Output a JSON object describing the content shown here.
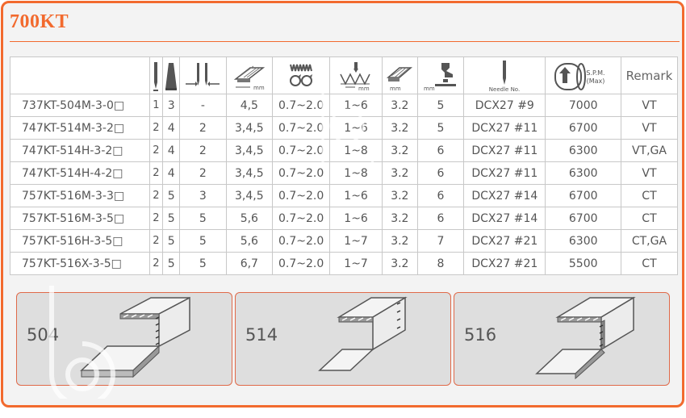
{
  "title": "700KT",
  "header": {
    "header_texts": {
      "mm": "mm",
      "needle_no": "Needle No.",
      "spm": "S.P.M.",
      "max": "(Max)",
      "remark": "Remark"
    },
    "icons": [
      "needle-count-icon",
      "thread-count-icon",
      "needle-gauge-icon",
      "overedge-width-icon",
      "differential-feed-icon",
      "stitch-length-icon",
      "stitch-width-icon",
      "presser-lift-icon",
      "needle-icon",
      "spm-motor-icon"
    ]
  },
  "rows": [
    {
      "model": "737KT-504M-3-0□",
      "needles": "1",
      "threads": "3",
      "gauge": "-",
      "width": "4,5",
      "diff": "0.7~2.0",
      "stitch": "1~6",
      "c8": "3.2",
      "lift": "5",
      "needle": "DCX27 #9",
      "spm": "7000",
      "remark": "VT"
    },
    {
      "model": "747KT-514M-3-2□",
      "needles": "2",
      "threads": "4",
      "gauge": "2",
      "width": "3,4,5",
      "diff": "0.7~2.0",
      "stitch": "1~6",
      "c8": "3.2",
      "lift": "5",
      "needle": "DCX27 #11",
      "spm": "6700",
      "remark": "VT"
    },
    {
      "model": "747KT-514H-3-2□",
      "needles": "2",
      "threads": "4",
      "gauge": "2",
      "width": "3,4,5",
      "diff": "0.7~2.0",
      "stitch": "1~8",
      "c8": "3.2",
      "lift": "6",
      "needle": "DCX27 #11",
      "spm": "6300",
      "remark": "VT,GA"
    },
    {
      "model": "747KT-514H-4-2□",
      "needles": "2",
      "threads": "4",
      "gauge": "2",
      "width": "3,4,5",
      "diff": "0.7~2.0",
      "stitch": "1~8",
      "c8": "3.2",
      "lift": "6",
      "needle": "DCX27 #11",
      "spm": "6300",
      "remark": "VT"
    },
    {
      "model": "757KT-516M-3-3□",
      "needles": "2",
      "threads": "5",
      "gauge": "3",
      "width": "3,4,5",
      "diff": "0.7~2.0",
      "stitch": "1~6",
      "c8": "3.2",
      "lift": "6",
      "needle": "DCX27 #14",
      "spm": "6700",
      "remark": "CT"
    },
    {
      "model": "757KT-516M-3-5□",
      "needles": "2",
      "threads": "5",
      "gauge": "5",
      "width": "5,6",
      "diff": "0.7~2.0",
      "stitch": "1~6",
      "c8": "3.2",
      "lift": "6",
      "needle": "DCX27 #14",
      "spm": "6700",
      "remark": "CT"
    },
    {
      "model": "757KT-516H-3-5□",
      "needles": "2",
      "threads": "5",
      "gauge": "5",
      "width": "5,6",
      "diff": "0.7~2.0",
      "stitch": "1~7",
      "c8": "3.2",
      "lift": "7",
      "needle": "DCX27 #21",
      "spm": "6300",
      "remark": "CT,GA"
    },
    {
      "model": "757KT-516X-3-5□",
      "needles": "2",
      "threads": "5",
      "gauge": "5",
      "width": "6,7",
      "diff": "0.7~2.0",
      "stitch": "1~7",
      "c8": "3.2",
      "lift": "8",
      "needle": "DCX27 #21",
      "spm": "5500",
      "remark": "CT"
    }
  ],
  "panels": [
    {
      "label": "504",
      "icon": "overlock-seam-504-icon"
    },
    {
      "label": "514",
      "icon": "overlock-seam-514-icon"
    },
    {
      "label": "516",
      "icon": "overlock-seam-516-icon"
    }
  ],
  "colors": {
    "accent": "#f26a2e",
    "border": "#c8c8c8",
    "panel_bg": "#dedede",
    "text": "#555555"
  }
}
